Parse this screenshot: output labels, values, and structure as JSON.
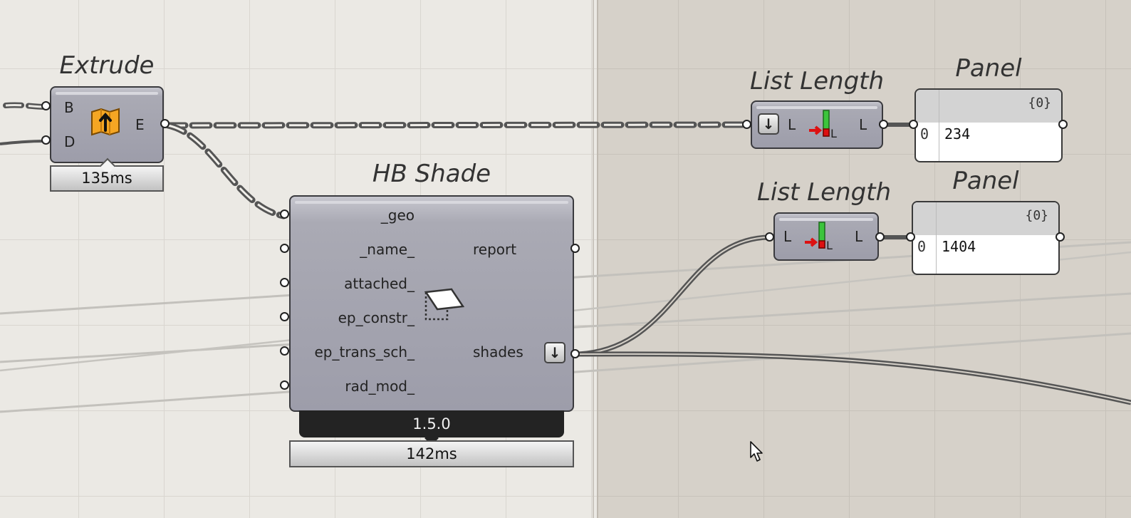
{
  "extrude": {
    "title": "Extrude",
    "input_b": "B",
    "input_d": "D",
    "output_e": "E",
    "timer": "135ms"
  },
  "hb_shade": {
    "title": "HB Shade",
    "inputs": [
      "_geo",
      "_name_",
      "attached_",
      "ep_constr_",
      "ep_trans_sch_",
      "rad_mod_"
    ],
    "outputs": [
      "report",
      "shades"
    ],
    "version": "1.5.0",
    "timer": "142ms"
  },
  "list_length_1": {
    "title": "List Length",
    "input": "L",
    "output": "L"
  },
  "list_length_2": {
    "title": "List Length",
    "input": "L",
    "output": "L"
  },
  "panel_1": {
    "title": "Panel",
    "path": "{0}",
    "index": "0",
    "value": "234"
  },
  "panel_2": {
    "title": "Panel",
    "path": "{0}",
    "index": "0",
    "value": "1404"
  },
  "colors": {
    "canvas": "#ebe9e4",
    "group": "#d6d1c9",
    "component": "#a4a4b0",
    "wire": "#5e5e5e"
  },
  "icons": {
    "extrude": "extrude-icon",
    "hb_shade": "shade-icon",
    "list_length": "list-length-icon",
    "flatten": "flatten-arrow-icon"
  }
}
